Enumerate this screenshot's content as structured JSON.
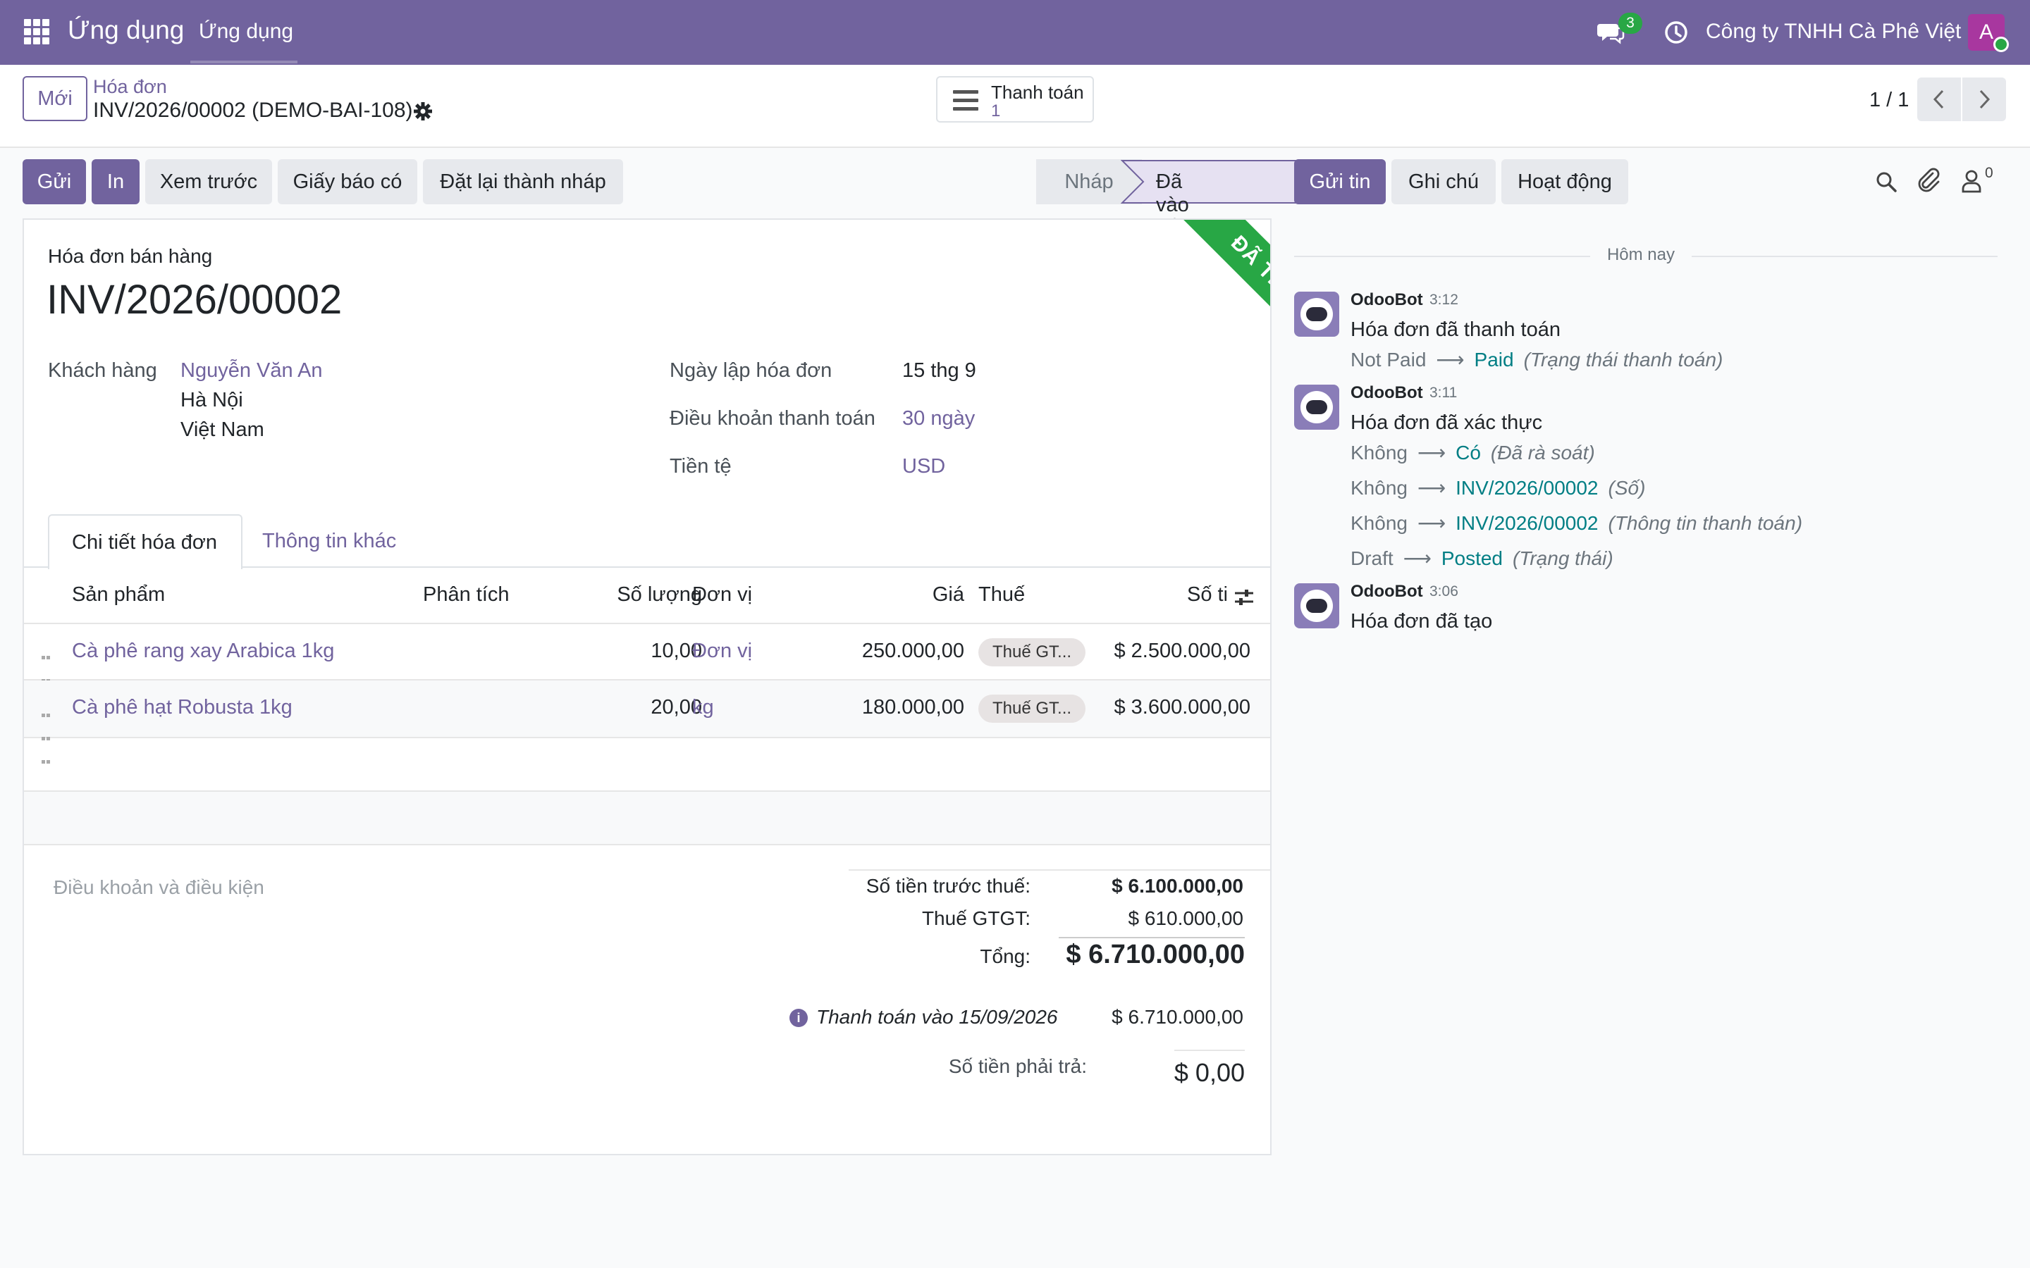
{
  "navbar": {
    "app_name": "Ứng dụng",
    "menu_item": "Ứng dụng",
    "chat_count": "3",
    "company": "Công ty TNHH Cà Phê Việt",
    "avatar_letter": "A",
    "color": "#71639e"
  },
  "control": {
    "new_label": "Mới",
    "breadcrumb_parent": "Hóa đơn",
    "breadcrumb_current": "INV/2026/00002 (DEMO-BAI-108)",
    "payments_label": "Thanh toán",
    "payments_count": "1",
    "pager": "1 / 1"
  },
  "actions": {
    "send": "Gửi",
    "print": "In",
    "preview": "Xem trước",
    "credit_note": "Giấy báo có",
    "reset_draft": "Đặt lại thành nháp"
  },
  "status": {
    "draft": "Nháp",
    "posted": "Đã vào sổ"
  },
  "form": {
    "ribbon": "ĐÃ THANH TOÁN",
    "move_type": "Hóa đơn bán hàng",
    "number": "INV/2026/00002",
    "customer_label": "Khách hàng",
    "customer_name": "Nguyễn Văn An",
    "customer_city": "Hà Nội",
    "customer_country": "Việt Nam",
    "invoice_date_label": "Ngày lập hóa đơn",
    "invoice_date": "15 thg 9",
    "payment_terms_label": "Điều khoản thanh toán",
    "payment_terms": "30 ngày",
    "currency_label": "Tiền tệ",
    "currency": "USD",
    "tabs": [
      "Chi tiết hóa đơn",
      "Thông tin khác"
    ]
  },
  "lines": {
    "headers": {
      "product": "Sản phẩm",
      "analytic": "Phân tích",
      "quantity": "Số lượng",
      "uom": "Đơn vị",
      "price": "Giá",
      "tax": "Thuế",
      "subtotal": "Số ti"
    },
    "rows": [
      {
        "product": "Cà phê rang xay Arabica 1kg",
        "quantity": "10,00",
        "uom": "Đơn vị",
        "price": "250.000,00",
        "tax": "Thuế GT...",
        "subtotal": "$ 2.500.000,00"
      },
      {
        "product": "Cà phê hạt Robusta 1kg",
        "quantity": "20,00",
        "uom": "kg",
        "price": "180.000,00",
        "tax": "Thuế GT...",
        "subtotal": "$ 3.600.000,00"
      }
    ]
  },
  "totals": {
    "terms_placeholder": "Điều khoản và điều kiện",
    "untaxed_label": "Số tiền trước thuế:",
    "untaxed": "$ 6.100.000,00",
    "tax_label": "Thuế GTGT:",
    "tax": "$ 610.000,00",
    "total_label": "Tổng:",
    "total": "$ 6.710.000,00",
    "payment_label": "Thanh toán vào 15/09/2026",
    "payment_amount": "$ 6.710.000,00",
    "residual_label": "Số tiền phải trả:",
    "residual": "$ 0,00"
  },
  "chatter": {
    "send_message": "Gửi tin",
    "log_note": "Ghi chú",
    "activity": "Hoạt động",
    "followers_count": "0",
    "date_separator": "Hôm nay",
    "messages": [
      {
        "author": "OdooBot",
        "time": "3:12",
        "body": "Hóa đơn đã thanh toán",
        "tracking": [
          {
            "old": "Not Paid",
            "new": "Paid",
            "field": "(Trạng thái thanh toán)"
          }
        ]
      },
      {
        "author": "OdooBot",
        "time": "3:11",
        "body": "Hóa đơn đã xác thực",
        "tracking": [
          {
            "old": "Không",
            "new": "Có",
            "field": "(Đã rà soát)"
          },
          {
            "old": "Không",
            "new": "INV/2026/00002",
            "field": "(Số)"
          },
          {
            "old": "Không",
            "new": "INV/2026/00002",
            "field": "(Thông tin thanh toán)"
          },
          {
            "old": "Draft",
            "new": "Posted",
            "field": "(Trạng thái)"
          }
        ]
      },
      {
        "author": "OdooBot",
        "time": "3:06",
        "body": "Hóa đơn đã tạo",
        "tracking": []
      }
    ]
  }
}
